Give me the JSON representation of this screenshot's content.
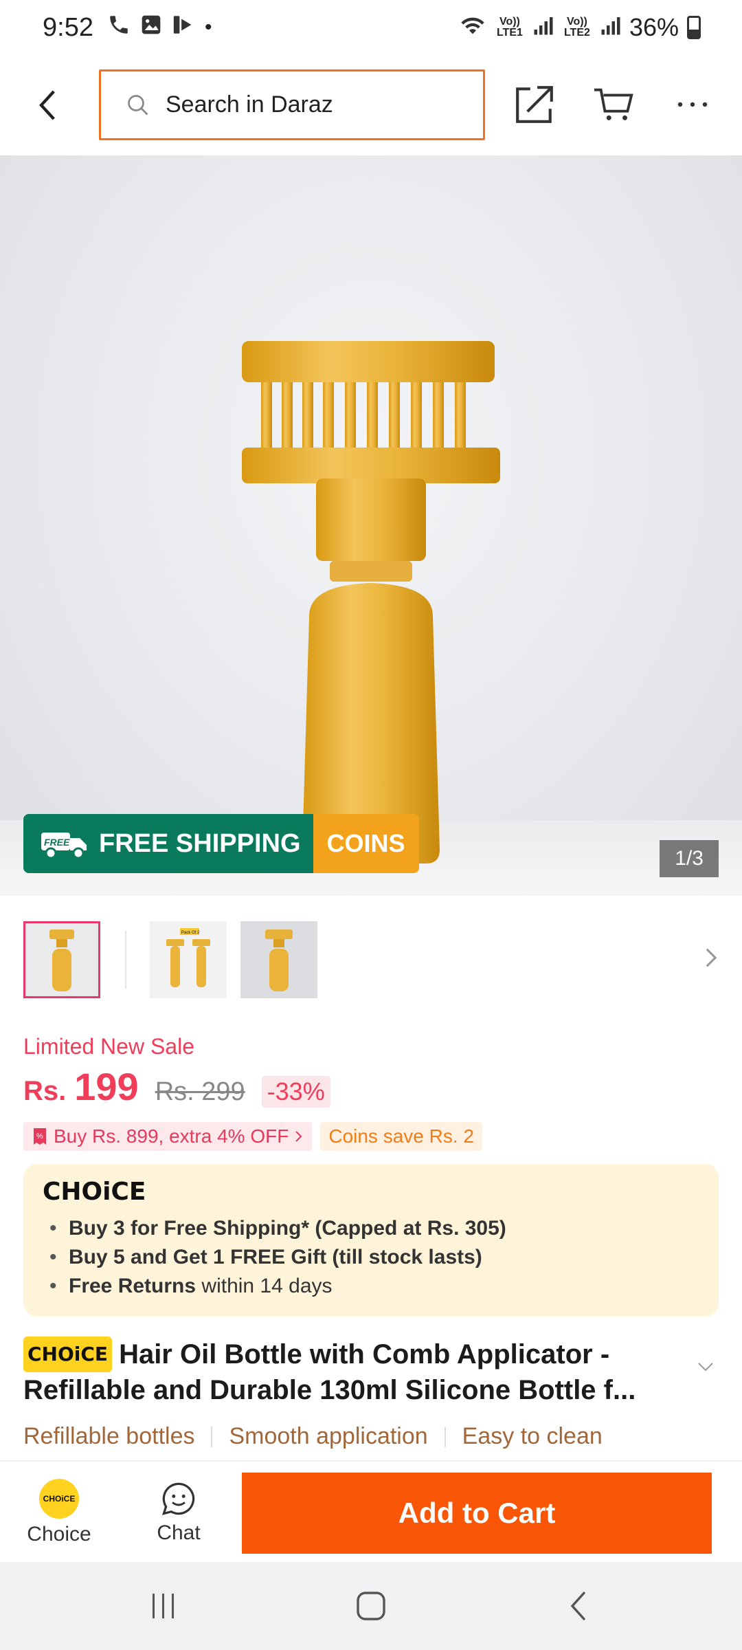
{
  "status_bar": {
    "time": "9:52",
    "sim1": "Vo)) LTE1",
    "sim2": "Vo)) LTE2",
    "battery": "36%"
  },
  "header": {
    "search_placeholder": "Search in Daraz"
  },
  "gallery": {
    "counter": "1/3",
    "banner_free": "FREE",
    "banner_shipping": "FREE SHIPPING",
    "banner_coins": "COINS",
    "thumb_badge": "Pack Of 2"
  },
  "pricing": {
    "sale_label": "Limited New Sale",
    "currency": "Rs.",
    "price": "199",
    "original_price": "Rs. 299",
    "discount": "-33%",
    "promo": "Buy Rs. 899, extra 4% OFF",
    "coins": "Coins save Rs. 2"
  },
  "choice": {
    "logo": "CHOiCE",
    "bullet1": "Buy 3 for  Free Shipping* (Capped at Rs. 305)",
    "bullet2": "Buy 5 and Get 1 FREE Gift (till stock lasts)",
    "bullet3_bold": "Free Returns",
    "bullet3_rest": " within 14 days"
  },
  "product": {
    "badge": "CHOiCE",
    "title": "Hair Oil Bottle with Comb Applicator - Refillable and Durable 130ml Silicone Bottle f...",
    "features": [
      "Refillable bottles",
      "Smooth application",
      "Easy to clean"
    ]
  },
  "bottom_bar": {
    "choice_label": "Choice",
    "choice_icon_text": "CHOiCE",
    "chat_label": "Chat",
    "add_to_cart": "Add to Cart"
  },
  "colors": {
    "accent": "#f85606",
    "price": "#ef3d5a",
    "shipping_green": "#0a7a5c",
    "coins_orange": "#f3a21c",
    "choice_yellow": "#ffd21f"
  }
}
